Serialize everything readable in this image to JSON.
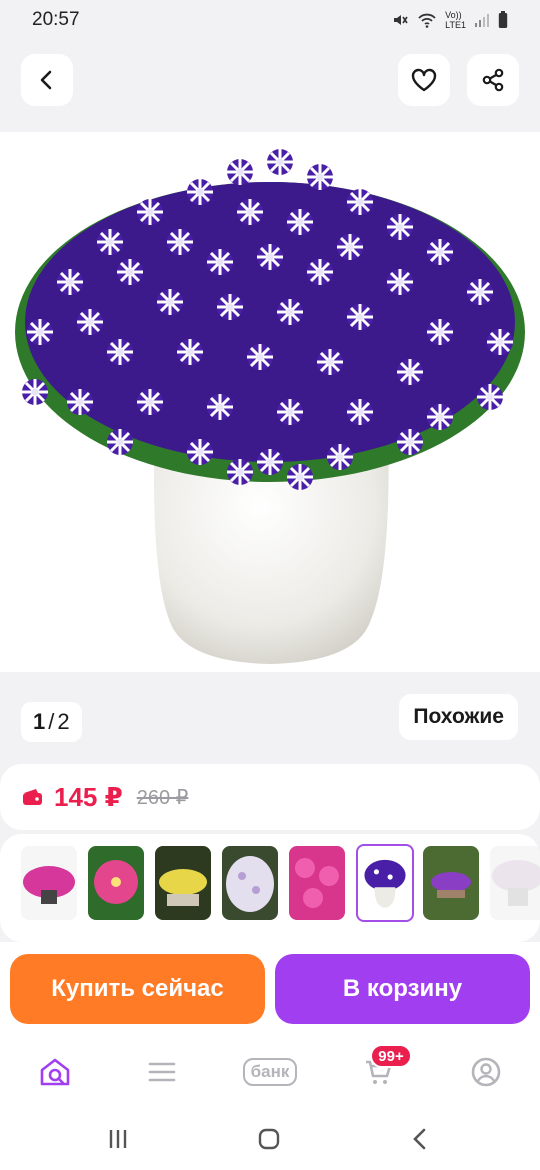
{
  "status_bar": {
    "time": "20:57",
    "network_label_top": "Vo))",
    "network_label_bottom": "LTE1"
  },
  "gallery": {
    "current": "1",
    "separator": "/",
    "total": "2",
    "similar_label": "Похожие"
  },
  "price": {
    "current": "145 ₽",
    "old": "260 ₽"
  },
  "thumbnails": [
    {
      "name": "pink-flowers-in-pot"
    },
    {
      "name": "pink-petunia-closeup"
    },
    {
      "name": "yellow-flowers-planter"
    },
    {
      "name": "white-lilac-flowers"
    },
    {
      "name": "pink-petunias"
    },
    {
      "name": "purple-petunia-in-white-pot",
      "selected": true
    },
    {
      "name": "purple-flowers-garden"
    },
    {
      "name": "white-flowers-pot"
    }
  ],
  "actions": {
    "buy_now": "Купить сейчас",
    "add_to_cart": "В корзину"
  },
  "bottom_nav": {
    "bank_label": "банк",
    "cart_badge": "99+"
  },
  "colors": {
    "accent_purple": "#a13ff0",
    "buy_orange": "#ff7b25",
    "price_red": "#ea1f4d"
  },
  "icons": [
    "back-icon",
    "heart-icon",
    "share-icon",
    "home-search-icon",
    "menu-icon",
    "cart-icon",
    "profile-icon",
    "recents-icon",
    "home-circle-icon",
    "back-triangle-icon"
  ]
}
